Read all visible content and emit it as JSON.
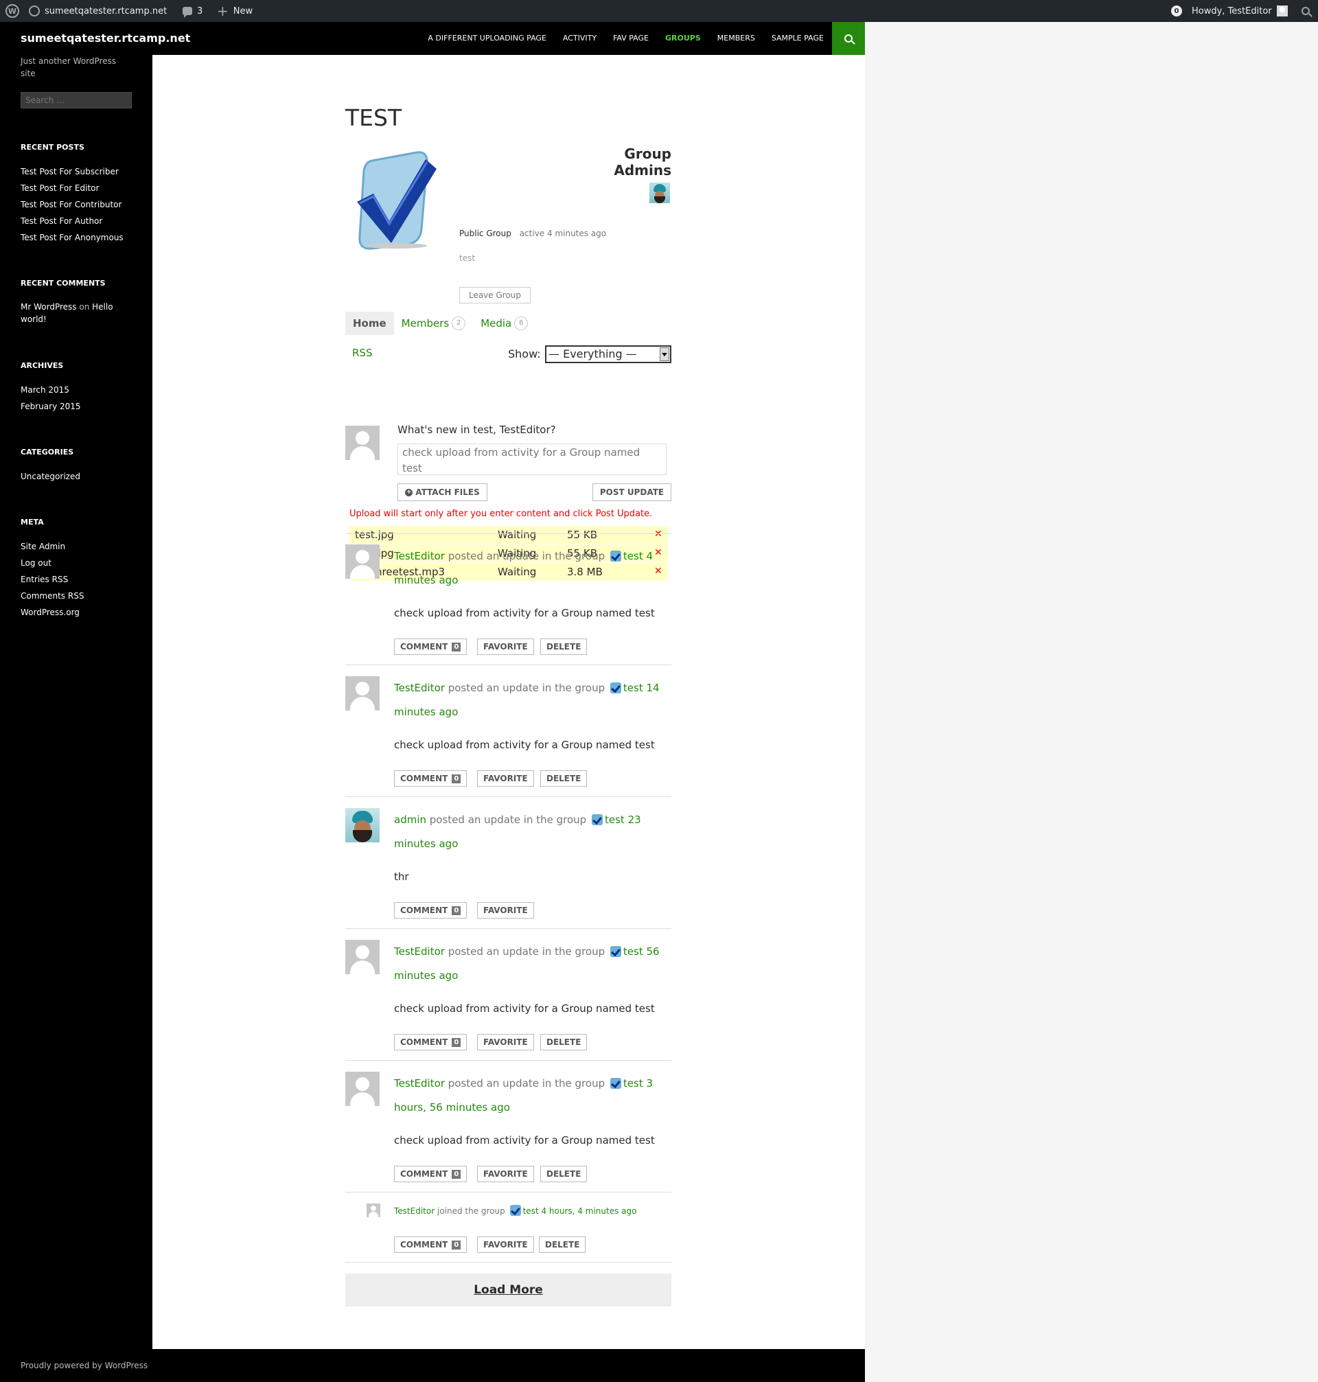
{
  "admin_bar": {
    "site_name": "sumeetqatester.rtcamp.net",
    "comments_count": "3",
    "new_label": "New",
    "notifications": "0",
    "howdy": "Howdy, TestEditor"
  },
  "header": {
    "site_title": "sumeetqatester.rtcamp.net",
    "nav": [
      "A DIFFERENT UPLOADING PAGE",
      "ACTIVITY",
      "FAV PAGE",
      "GROUPS",
      "MEMBERS",
      "SAMPLE PAGE"
    ],
    "current_nav": "GROUPS"
  },
  "sidebar": {
    "tagline": "Just another WordPress site",
    "search_placeholder": "Search …",
    "recent_posts_title": "RECENT POSTS",
    "recent_posts": [
      "Test Post For Subscriber",
      "Test Post For Editor",
      "Test Post For Contributor",
      "Test Post For Author",
      "Test Post For Anonymous"
    ],
    "recent_comments_title": "RECENT COMMENTS",
    "recent_comment": {
      "author": "Mr WordPress",
      "on": "on",
      "post": "Hello world!"
    },
    "archives_title": "ARCHIVES",
    "archives": [
      "March 2015",
      "February 2015"
    ],
    "categories_title": "CATEGORIES",
    "categories": [
      "Uncategorized"
    ],
    "meta_title": "META",
    "meta": [
      "Site Admin",
      "Log out",
      "Entries RSS",
      "Comments RSS",
      "WordPress.org"
    ]
  },
  "group": {
    "title": "TEST",
    "admins_title": "Group Admins",
    "status": "Public Group",
    "active": "active 4 minutes ago",
    "description": "test",
    "leave_label": "Leave Group",
    "tabs": [
      {
        "label": "Home",
        "count": ""
      },
      {
        "label": "Members",
        "count": "2"
      },
      {
        "label": "Media",
        "count": "6"
      }
    ]
  },
  "filter": {
    "rss": "RSS",
    "show_label": "Show:",
    "selected": "— Everything —"
  },
  "post_form": {
    "prompt": "What's new in test, TestEditor?",
    "content": "check upload from activity for a Group named test",
    "attach_label": "ATTACH FILES",
    "post_label": "POST UPDATE",
    "notice": "Upload will start only after you enter content and click Post Update."
  },
  "queue": [
    {
      "name": "test.jpg",
      "status": "Waiting",
      "size": "55 KB"
    },
    {
      "name": "test.jpg",
      "status": "Waiting",
      "size": "55 KB"
    },
    {
      "name": "mpthreetest.mp3",
      "status": "Waiting",
      "size": "3.8 MB"
    }
  ],
  "activity": [
    {
      "user": "TestEditor",
      "action": "posted an update in the group",
      "group": "test",
      "time": "4 minutes ago",
      "body": "check upload from activity for a Group named test",
      "comment_label": "COMMENT",
      "comment_count": "0",
      "favorite_label": "FAVORITE",
      "delete_label": "DELETE"
    },
    {
      "user": "TestEditor",
      "action": "posted an update in the group",
      "group": "test",
      "time": "14 minutes ago",
      "body": "check upload from activity for a Group named test",
      "comment_label": "COMMENT",
      "comment_count": "0",
      "favorite_label": "FAVORITE",
      "delete_label": "DELETE"
    },
    {
      "user": "admin",
      "action": "posted an update in the group",
      "group": "test",
      "time": "23 minutes ago",
      "body": "thr",
      "comment_label": "COMMENT",
      "comment_count": "0",
      "favorite_label": "FAVORITE",
      "delete_label": ""
    },
    {
      "user": "TestEditor",
      "action": "posted an update in the group",
      "group": "test",
      "time": "56 minutes ago",
      "body": "check upload from activity for a Group named test",
      "comment_label": "COMMENT",
      "comment_count": "0",
      "favorite_label": "FAVORITE",
      "delete_label": "DELETE"
    },
    {
      "user": "TestEditor",
      "action": "posted an update in the group",
      "group": "test",
      "time": "3 hours, 56 minutes ago",
      "body": "check upload from activity for a Group named test",
      "comment_label": "COMMENT",
      "comment_count": "0",
      "favorite_label": "FAVORITE",
      "delete_label": "DELETE"
    },
    {
      "user": "TestEditor",
      "action": "joined the group",
      "group": "test",
      "time": "4 hours, 4 minutes ago",
      "body": "",
      "comment_label": "COMMENT",
      "comment_count": "0",
      "favorite_label": "FAVORITE",
      "delete_label": "DELETE"
    }
  ],
  "load_more": "Load More",
  "footer": "Proudly powered by WordPress"
}
